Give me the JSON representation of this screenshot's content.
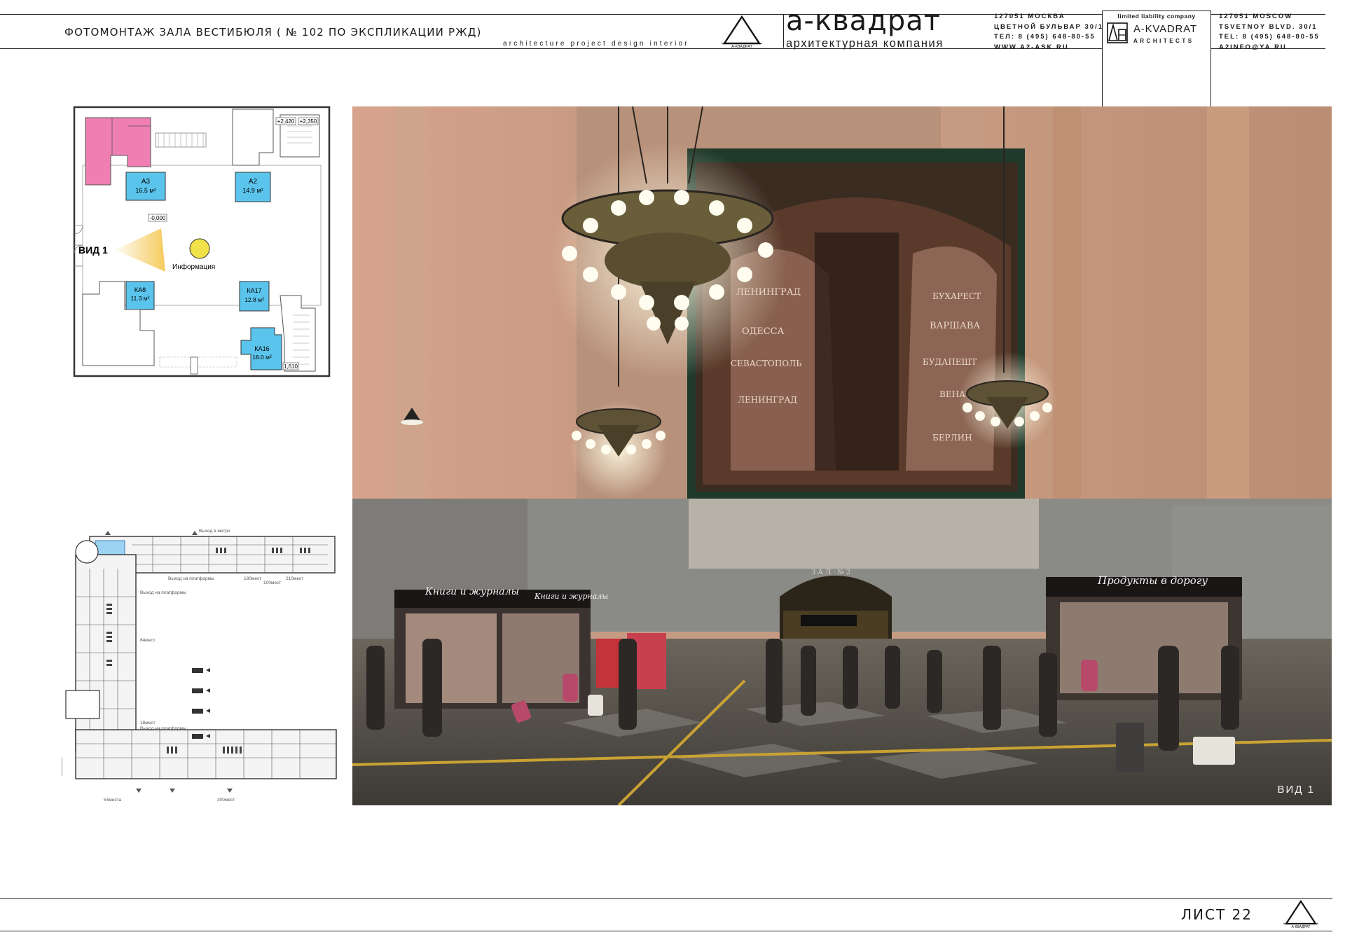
{
  "header": {
    "title": "ФОТОМОНТАЖ  ЗАЛА ВЕСТИБЮЛЯ  ( № 102 ПО ЭКСПЛИКАЦИИ РЖД)",
    "tagline": "architecture   project   design   interior",
    "logo_caption": "А-КВАДРАТ",
    "brand": "а-квадрат",
    "brand_subtitle": "архитектурная компания",
    "address_ru": [
      "127051 МОСКВА",
      "ЦВЕТНОЙ БУЛЬВАР 30/1",
      "ТЕЛ: 8 (495) 648-80-55",
      "WWW.A2-ASK.RU"
    ],
    "llc_label": "limited liability company",
    "llc_name": "A-KVADRAT",
    "llc_sub": "ARCHITECTS",
    "address_en": [
      "127051 MOSCOW",
      "TSVETNOY BLVD. 30/1",
      "TEL: 8 (495) 648-80-55",
      "A2INFO@YA.RU"
    ]
  },
  "plan_top": {
    "view_label": "ВИД 1",
    "info_label": "Информация",
    "levels": [
      "+2,420",
      "+2,350",
      "-0,000",
      "1,610"
    ],
    "rooms": [
      {
        "code": "А3",
        "area": "16.5 м²"
      },
      {
        "code": "А2",
        "area": "14.9 м²"
      },
      {
        "code": "КА8",
        "area": "11.3 м²"
      },
      {
        "code": "КА17",
        "area": "12.8 м²"
      },
      {
        "code": "КА16",
        "area": "18.0 м²"
      }
    ]
  },
  "plan_bottom": {
    "labels": [
      "Выход в метро",
      "Выход на платформы",
      "180мест",
      "100мест",
      "210мест",
      "Выход на платформы",
      "64мест",
      "18мест",
      "Выход на платформы",
      "54места",
      "300мест"
    ]
  },
  "photo": {
    "shop_left": "Книги и журналы",
    "shop_left_2": "Книги и журналы",
    "shop_right": "Продукты в дорогу",
    "hall_sign": "ЗАЛ №2",
    "mural_cities_left": [
      "ЛЕНИНГРАД",
      "ОДЕССА",
      "СЕВАСТОПОЛЬ",
      "ЛЕНИНГРАД"
    ],
    "mural_cities_right": [
      "БУХАРЕСТ",
      "ВАРШАВА",
      "БУДАПЕШТ",
      "ВЕНА",
      "БЕРЛИН"
    ],
    "view_caption": "ВИД 1"
  },
  "footer": {
    "sheet": "ЛИСТ 22",
    "logo_caption": "А-КВАДРАТ"
  }
}
